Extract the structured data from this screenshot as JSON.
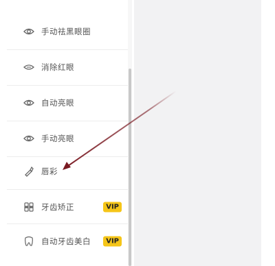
{
  "menu": {
    "items": [
      {
        "label": "手动祛黑眼圈",
        "icon": "eye-icon",
        "vip": ""
      },
      {
        "label": "消除红眼",
        "icon": "eye-outline-icon",
        "vip": ""
      },
      {
        "label": "自动亮眼",
        "icon": "eye-icon",
        "vip": ""
      },
      {
        "label": "手动亮眼",
        "icon": "eye-icon",
        "vip": ""
      },
      {
        "label": "唇彩",
        "icon": "lip-brush-icon",
        "vip": ""
      },
      {
        "label": "牙齿矫正",
        "icon": "braces-icon",
        "vip": "VIP"
      },
      {
        "label": "自动牙齿美白",
        "icon": "tooth-icon",
        "vip": "VIP"
      }
    ]
  },
  "colors": {
    "vip_badge": "#f5c518",
    "arrow": "#7a1a22",
    "right_panel": "#f2f2f3"
  }
}
